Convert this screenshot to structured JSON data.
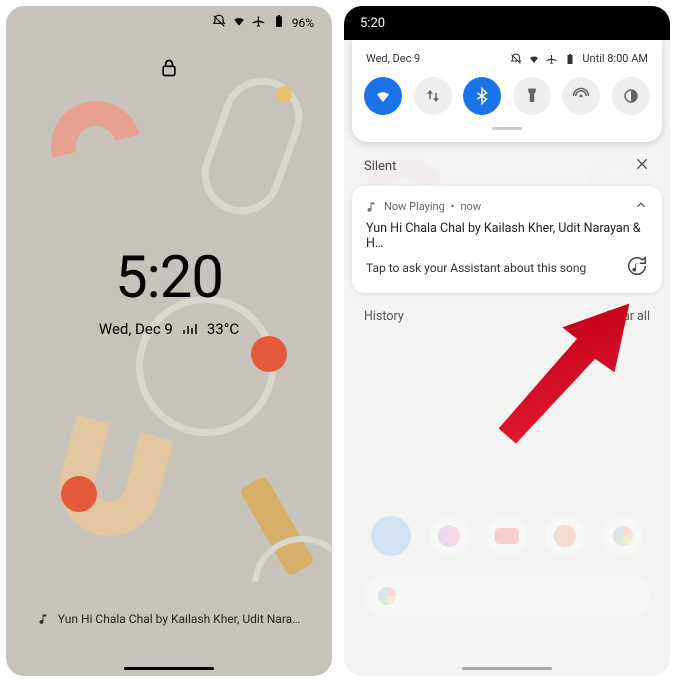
{
  "left": {
    "status": {
      "battery": "96%"
    },
    "clock": "5:20",
    "date": "Wed, Dec 9",
    "temp": "33°C",
    "now_playing": "Yun Hi Chala Chal by Kailash Kher, Udit Nara…"
  },
  "right": {
    "status_time": "5:20",
    "qs": {
      "date": "Wed, Dec 9",
      "alarm": "Until 8:00 AM",
      "toggles": [
        {
          "name": "wifi",
          "active": true
        },
        {
          "name": "mobile-data",
          "active": false
        },
        {
          "name": "bluetooth",
          "active": true
        },
        {
          "name": "flashlight",
          "active": false
        },
        {
          "name": "hotspot",
          "active": false
        },
        {
          "name": "dark-mode",
          "active": false
        }
      ]
    },
    "silent_header": "Silent",
    "notification": {
      "app": "Now Playing",
      "time": "now",
      "title": "Yun Hi Chala Chal by Kailash Kher, Udit Narayan & H…",
      "subtitle": "Tap to ask your Assistant about this song"
    },
    "footer": {
      "history": "History",
      "clear_all": "Clear all"
    }
  },
  "annotation": {
    "arrow_color": "#e2182f"
  }
}
